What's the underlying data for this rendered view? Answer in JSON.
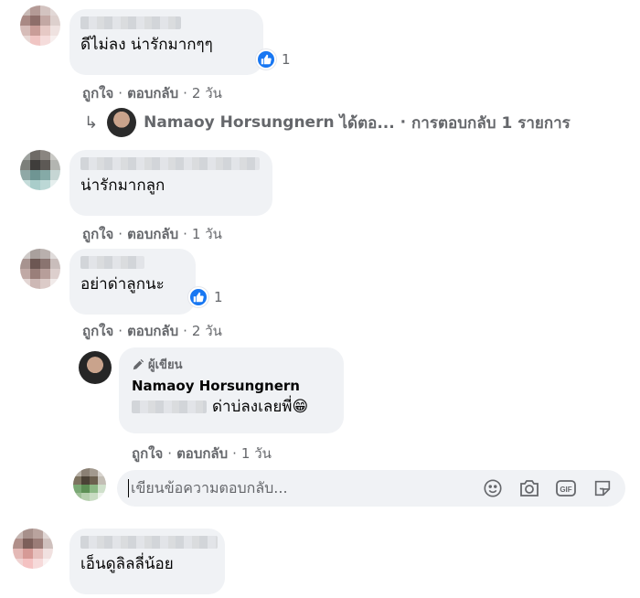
{
  "comments": [
    {
      "text": "ดีไม่ลง น่ารักมากๆๆ",
      "reaction_count": "1",
      "actions": {
        "like": "ถูกใจ",
        "reply": "ตอบกลับ",
        "time": "2 วัน"
      },
      "reply_link": {
        "arrow": "↳",
        "user": "Namaoy Horsungnern",
        "verb": "ได้ตอ...",
        "sep": "·",
        "summary": "การตอบกลับ 1 รายการ"
      }
    },
    {
      "text": "น่ารักมากลูก",
      "actions": {
        "like": "ถูกใจ",
        "reply": "ตอบกลับ",
        "time": "1 วัน"
      }
    },
    {
      "text": "อย่าด่าลูกนะ",
      "reaction_count": "1",
      "actions": {
        "like": "ถูกใจ",
        "reply": "ตอบกลับ",
        "time": "2 วัน"
      }
    },
    {
      "text": "เอ็นดูลิลลี่น้อย"
    }
  ],
  "reply": {
    "badge": "ผู้เขียน",
    "author": "Namaoy Horsungnern",
    "text": "ด่าบ่ลงเลยพี่😁",
    "actions": {
      "like": "ถูกใจ",
      "reply": "ตอบกลับ",
      "time": "1 วัน"
    }
  },
  "reply_input": {
    "placeholder": "เขียนข้อความตอบกลับ...",
    "tools": [
      "emoji-icon",
      "camera-icon",
      "gif-icon",
      "sticker-icon"
    ]
  },
  "colors": {
    "like_blue": "#1877f2",
    "bubble": "#f0f2f5",
    "meta": "#65676b"
  }
}
